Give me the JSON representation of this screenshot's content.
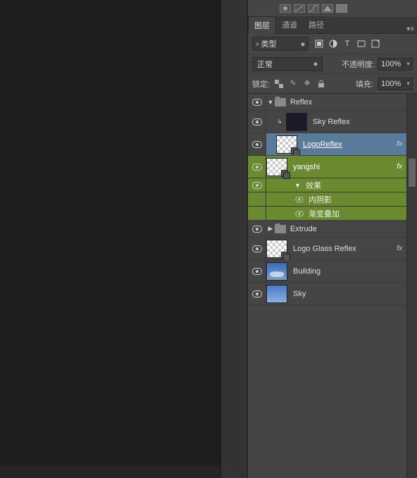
{
  "tabs": {
    "layers": "图层",
    "channels": "通道",
    "paths": "路径"
  },
  "filter": {
    "label": "类型"
  },
  "blend": {
    "mode": "正常"
  },
  "opacity": {
    "label": "不透明度:",
    "value": "100%"
  },
  "fill": {
    "label": "填充:",
    "value": "100%"
  },
  "lock": {
    "label": "锁定:"
  },
  "layers": {
    "reflex_group": "Reflex",
    "sky_reflex": "Sky Reflex",
    "logo_reflex": "LogoReflex ",
    "yangshi": "yangshi",
    "fx_title": "效果",
    "fx_inner_shadow": "内阴影",
    "fx_gradient_overlay": "渐变叠加",
    "extrude_group": "Extrude",
    "logo_glass": "Logo Glass Reflex",
    "building": "Building",
    "sky": "Sky"
  },
  "fx_badge": "fx"
}
